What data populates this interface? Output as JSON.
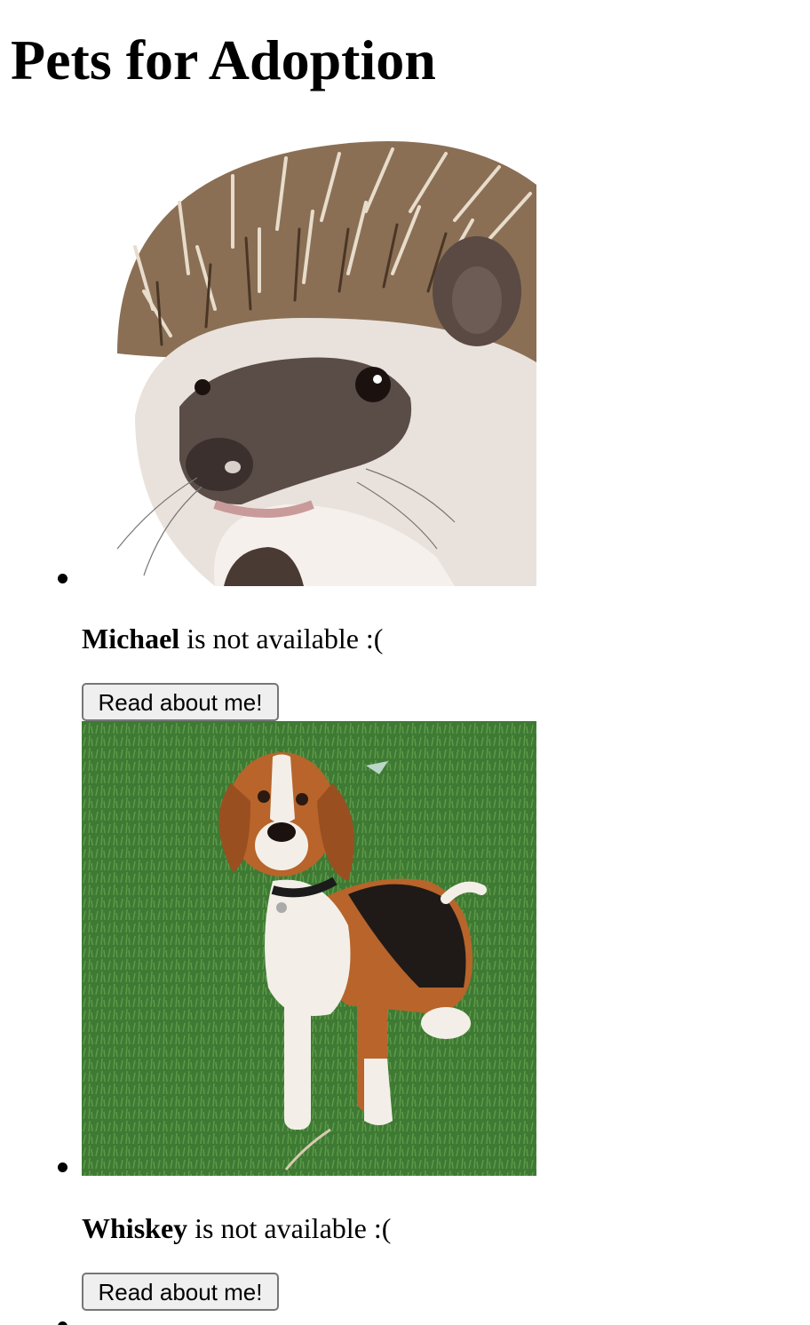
{
  "page": {
    "title": "Pets for Adoption"
  },
  "pets": [
    {
      "name": "Michael",
      "status_text": " is not available :(",
      "button_label": "Read about me!",
      "photo": "hedgehog-photo"
    },
    {
      "name": "Whiskey",
      "status_text": " is not available :(",
      "button_label": "Read about me!",
      "photo": "beagle-photo"
    }
  ],
  "colors": {
    "grass": "#3f7a34",
    "beagle_tan": "#b8642b",
    "hedgehog_spine": "#8a6f55"
  }
}
